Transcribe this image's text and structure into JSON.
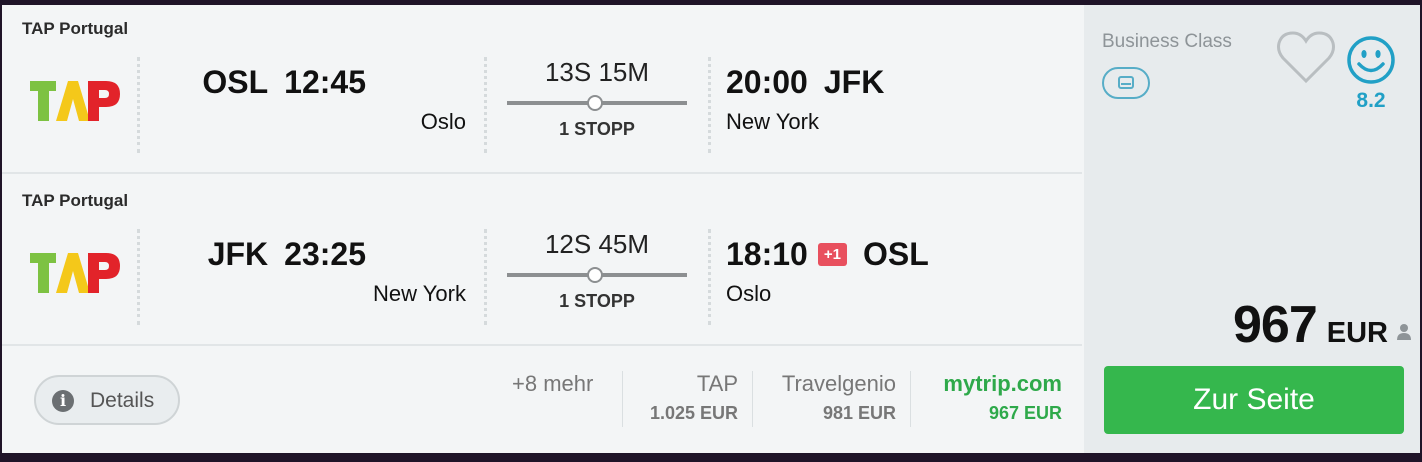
{
  "legs": [
    {
      "airline": "TAP Portugal",
      "dep_code": "OSL",
      "dep_time": "12:45",
      "dep_city": "Oslo",
      "duration": "13S 15M",
      "stops": "1 STOPP",
      "arr_time": "20:00",
      "arr_day_offset": "",
      "arr_code": "JFK",
      "arr_city": "New York"
    },
    {
      "airline": "TAP Portugal",
      "dep_code": "JFK",
      "dep_time": "23:25",
      "dep_city": "New York",
      "duration": "12S 45M",
      "stops": "1 STOPP",
      "arr_time": "18:10",
      "arr_day_offset": "+1",
      "arr_code": "OSL",
      "arr_city": "Oslo"
    }
  ],
  "footer": {
    "details_label": "Details",
    "more_label": "+8 mehr",
    "providers": [
      {
        "name": "TAP",
        "price": "1.025 EUR"
      },
      {
        "name": "Travelgenio",
        "price": "981 EUR"
      },
      {
        "name": "mytrip.com",
        "price": "967 EUR"
      }
    ]
  },
  "side": {
    "cabin_class": "Business Class",
    "rating": "8.2",
    "price": "967",
    "currency": "EUR",
    "cta_label": "Zur Seite"
  },
  "icons": [
    "info-icon",
    "seat-icon",
    "heart-icon",
    "smiley-icon",
    "person-icon"
  ],
  "colors": {
    "accent_green": "#35b74d",
    "rating_blue": "#21a0c6",
    "day_offset_red": "#e8505e",
    "tap_green": "#7dc242",
    "tap_red": "#e2232a",
    "tap_yellow": "#f4c81a"
  }
}
